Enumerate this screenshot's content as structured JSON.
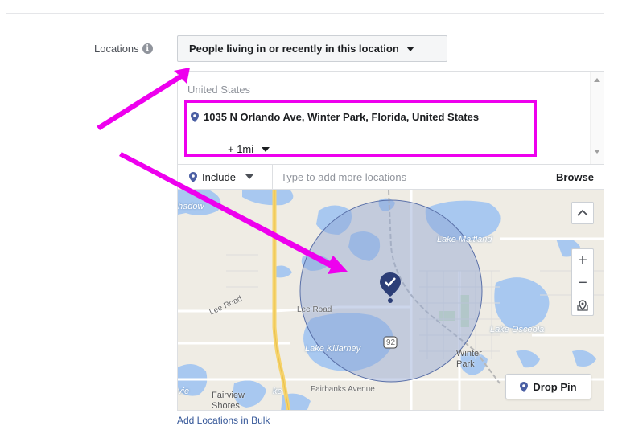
{
  "locations": {
    "label": "Locations",
    "info_icon": "i",
    "audience_type": "People living in or recently in this location",
    "country": "United States",
    "selected_location": "1035 N Orlando Ave, Winter Park, Florida, United States",
    "radius": "+ 1mi",
    "include_label": "Include",
    "search_placeholder": "Type to add more locations",
    "browse_label": "Browse",
    "add_bulk_link": "Add Locations in Bulk"
  },
  "map": {
    "labels": {
      "shadow": "hadow",
      "lake_maitland": "Lake Maitland",
      "lee_road_1": "Lee Road",
      "lee_road_2": "Lee Road",
      "lake_osceola": "Lake Osceola",
      "lake_killarney": "Lake Killarney",
      "route_92": "92",
      "winter_park": "Winter\nPark",
      "fairbanks": "Fairbanks Avenue",
      "fairview": "Fairview\nShores",
      "vie": "vie",
      "ke": "ke"
    },
    "zoom_in": "+",
    "zoom_out": "−",
    "scroll_up": "^",
    "drop_pin_label": "Drop Pin"
  },
  "colors": {
    "annotation": "#ee00ee",
    "pin": "#2c3e77",
    "water": "#a8c8f0",
    "radius_fill": "#8ea4d2",
    "link": "#365899"
  }
}
